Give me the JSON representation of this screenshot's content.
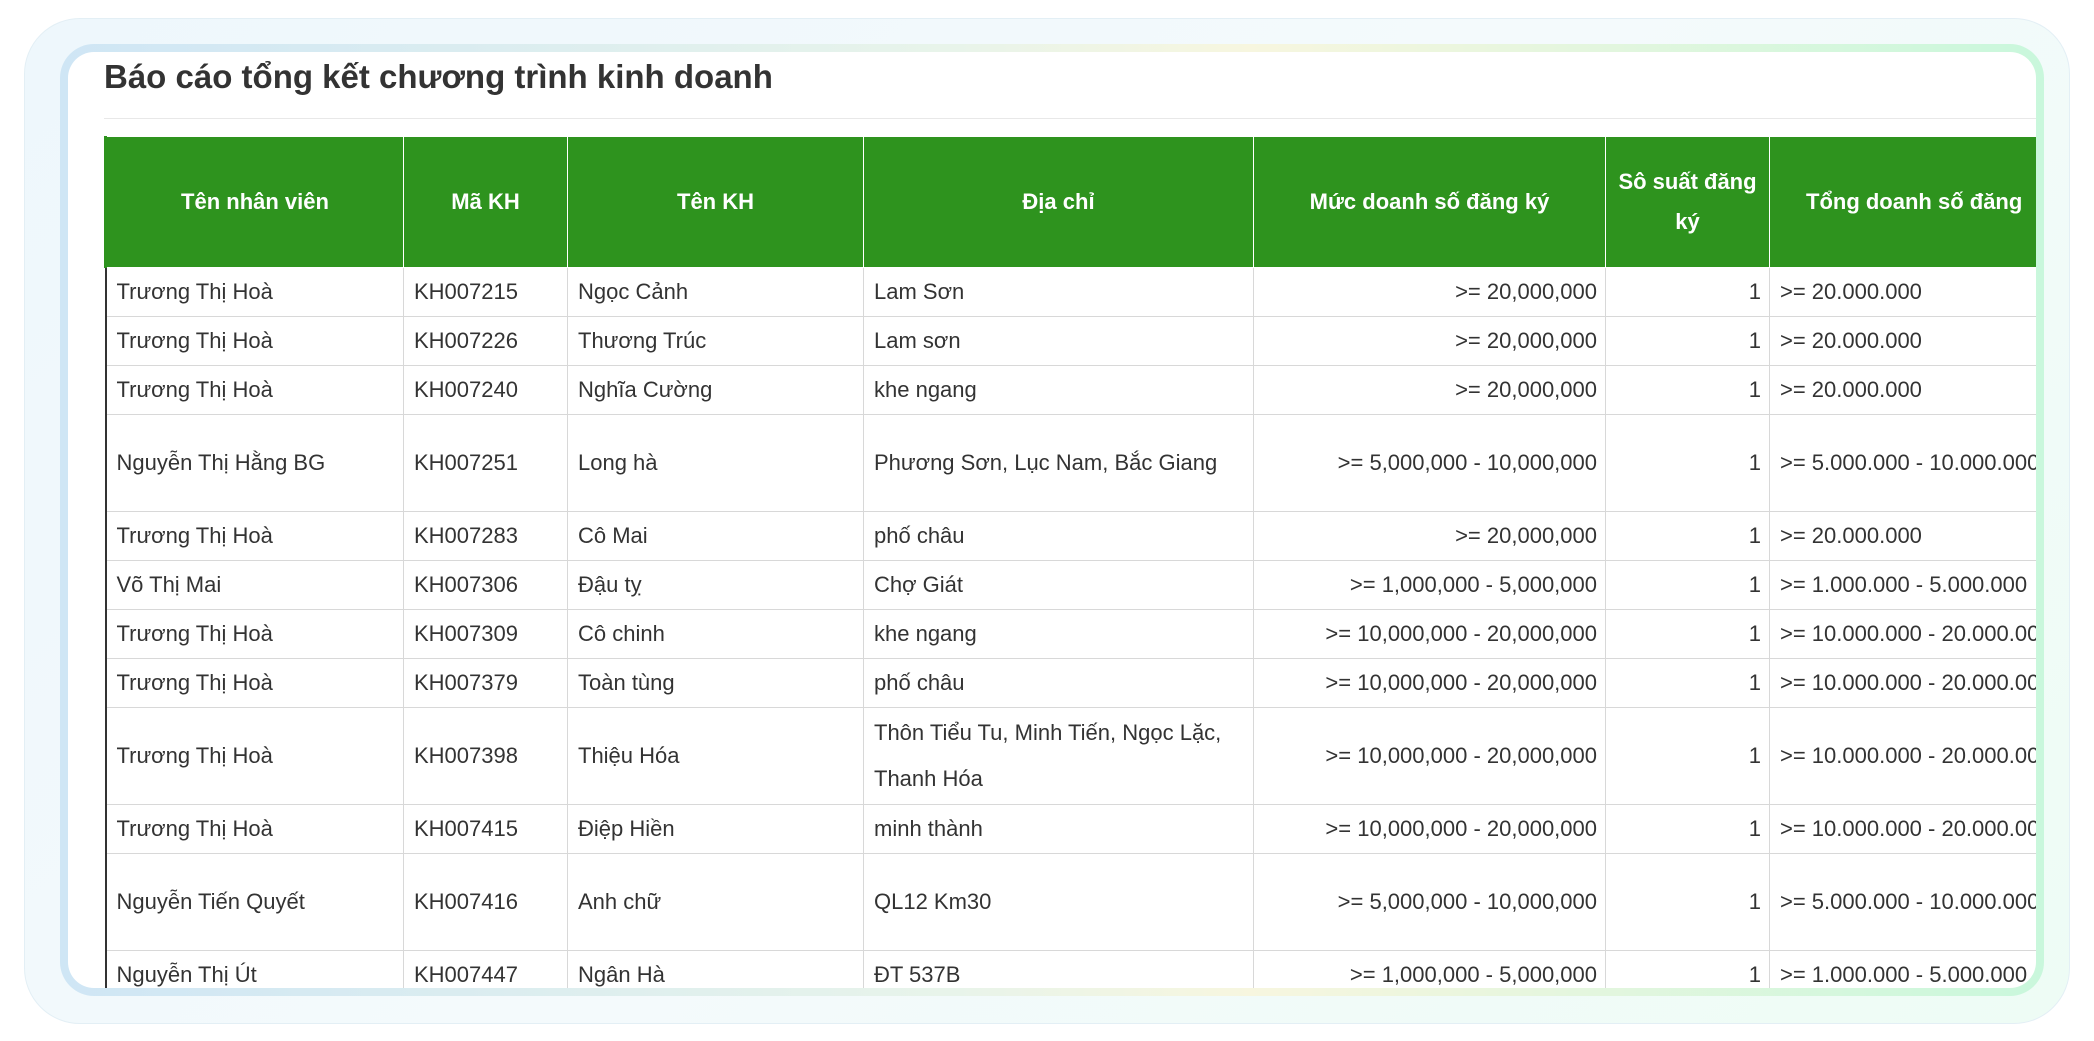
{
  "title": "Báo cáo tổng kết chương trình kinh doanh",
  "columns": [
    "Tên nhân viên",
    "Mã KH",
    "Tên KH",
    "Địa chỉ",
    "Mức doanh số đăng ký",
    "Sô suất đăng ký",
    "Tổng doanh số đăng"
  ],
  "rows": [
    {
      "employee": "Trương Thị Hoà",
      "code": "KH007215",
      "customer": "Ngọc Cảnh",
      "address": "Lam Sơn",
      "level": ">= 20,000,000",
      "count": "1",
      "total": ">= 20.000.000",
      "tall": false
    },
    {
      "employee": "Trương Thị Hoà",
      "code": "KH007226",
      "customer": "Thương Trúc",
      "address": "Lam sơn",
      "level": ">= 20,000,000",
      "count": "1",
      "total": ">= 20.000.000",
      "tall": false
    },
    {
      "employee": "Trương Thị Hoà",
      "code": "KH007240",
      "customer": "Nghĩa Cường",
      "address": "khe ngang",
      "level": ">= 20,000,000",
      "count": "1",
      "total": ">= 20.000.000",
      "tall": false
    },
    {
      "employee": "Nguyễn Thị Hằng BG",
      "code": "KH007251",
      "customer": "Long hà",
      "address": "Phương Sơn, Lục Nam, Bắc Giang",
      "level": ">= 5,000,000 - 10,000,000",
      "count": "1",
      "total": ">= 5.000.000 - 10.000.000",
      "tall": true
    },
    {
      "employee": "Trương Thị Hoà",
      "code": "KH007283",
      "customer": "Cô Mai",
      "address": "phố châu",
      "level": ">= 20,000,000",
      "count": "1",
      "total": ">= 20.000.000",
      "tall": false
    },
    {
      "employee": "Võ Thị Mai",
      "code": "KH007306",
      "customer": "Đậu tỵ",
      "address": "Chợ Giát",
      "level": ">= 1,000,000 - 5,000,000",
      "count": "1",
      "total": ">= 1.000.000 - 5.000.000",
      "tall": false
    },
    {
      "employee": "Trương Thị Hoà",
      "code": "KH007309",
      "customer": "Cô chinh",
      "address": "khe ngang",
      "level": ">= 10,000,000 - 20,000,000",
      "count": "1",
      "total": ">= 10.000.000 - 20.000.00",
      "tall": false
    },
    {
      "employee": "Trương Thị Hoà",
      "code": "KH007379",
      "customer": "Toàn tùng",
      "address": "phố châu",
      "level": ">= 10,000,000 - 20,000,000",
      "count": "1",
      "total": ">= 10.000.000 - 20.000.00",
      "tall": false
    },
    {
      "employee": "Trương Thị Hoà",
      "code": "KH007398",
      "customer": "Thiệu Hóa",
      "address": "Thôn Tiểu Tu, Minh Tiến, Ngọc Lặc, Thanh Hóa",
      "level": ">= 10,000,000 - 20,000,000",
      "count": "1",
      "total": ">= 10.000.000 - 20.000.00",
      "tall": true
    },
    {
      "employee": "Trương Thị Hoà",
      "code": "KH007415",
      "customer": "Điệp Hiền",
      "address": "minh thành",
      "level": ">= 10,000,000 - 20,000,000",
      "count": "1",
      "total": ">= 10.000.000 - 20.000.00",
      "tall": false
    },
    {
      "employee": "Nguyễn Tiến Quyết",
      "code": "KH007416",
      "customer": "Anh chữ",
      "address": "QL12 Km30",
      "level": ">= 5,000,000 - 10,000,000",
      "count": "1",
      "total": ">= 5.000.000 - 10.000.000",
      "tall": true
    },
    {
      "employee": "Nguyễn Thị Út",
      "code": "KH007447",
      "customer": "Ngân Hà",
      "address": "ĐT 537B",
      "level": ">= 1,000,000 - 5,000,000",
      "count": "1",
      "total": ">= 1.000.000 - 5.000.000",
      "tall": false
    }
  ],
  "colors": {
    "header_bg": "#2e931e",
    "header_text": "#ffffff",
    "grid": "#d8d8d8"
  }
}
